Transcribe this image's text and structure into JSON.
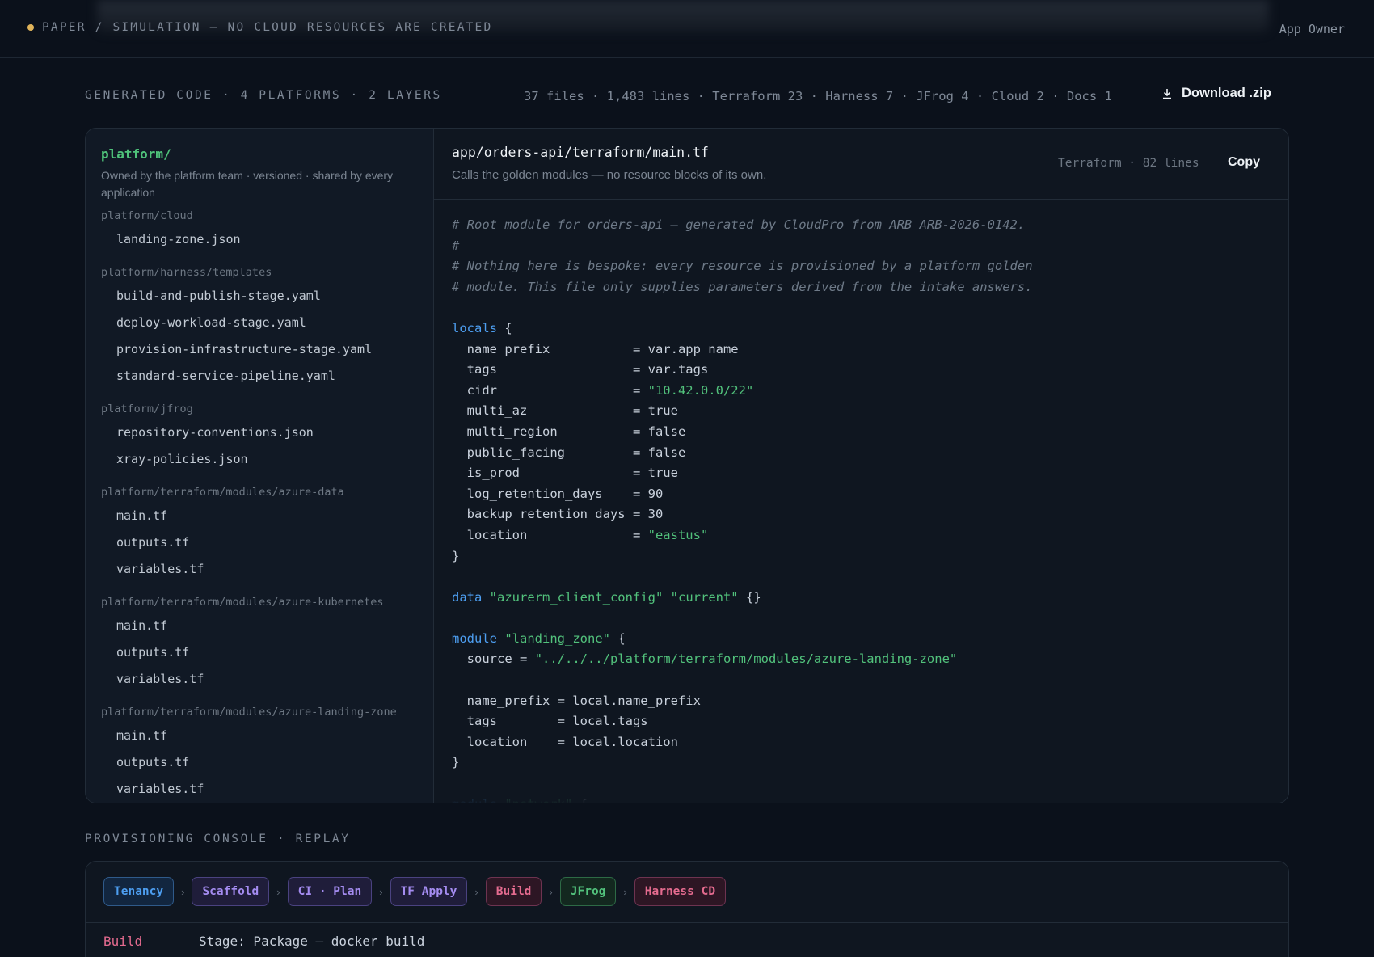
{
  "topbar": {
    "status": "PAPER / SIMULATION — NO CLOUD RESOURCES ARE CREATED",
    "role": "App Owner"
  },
  "summary": {
    "heading": "GENERATED CODE · 4 PLATFORMS · 2 LAYERS",
    "stats": "37 files · 1,483 lines · Terraform 23 · Harness 7 · JFrog 4 · Cloud 2 · Docs 1",
    "download_label": "Download .zip"
  },
  "tree": {
    "root": "platform/",
    "description": "Owned by the platform team · versioned · shared by every application",
    "groups": [
      {
        "name": "platform/cloud",
        "files": [
          "landing-zone.json"
        ]
      },
      {
        "name": "platform/harness/templates",
        "files": [
          "build-and-publish-stage.yaml",
          "deploy-workload-stage.yaml",
          "provision-infrastructure-stage.yaml",
          "standard-service-pipeline.yaml"
        ]
      },
      {
        "name": "platform/jfrog",
        "files": [
          "repository-conventions.json",
          "xray-policies.json"
        ]
      },
      {
        "name": "platform/terraform/modules/azure-data",
        "files": [
          "main.tf",
          "outputs.tf",
          "variables.tf"
        ]
      },
      {
        "name": "platform/terraform/modules/azure-kubernetes",
        "files": [
          "main.tf",
          "outputs.tf",
          "variables.tf"
        ]
      },
      {
        "name": "platform/terraform/modules/azure-landing-zone",
        "files": [
          "main.tf",
          "outputs.tf",
          "variables.tf"
        ]
      }
    ]
  },
  "editor": {
    "path": "app/orders-api/terraform/main.tf",
    "description": "Calls the golden modules — no resource blocks of its own.",
    "meta": "Terraform · 82 lines",
    "copy_label": "Copy",
    "code": [
      [
        [
          "cm",
          "# Root module for orders-api — generated by CloudPro from ARB ARB-2026-0142."
        ]
      ],
      [
        [
          "cm",
          "#"
        ]
      ],
      [
        [
          "cm",
          "# Nothing here is bespoke: every resource is provisioned by a platform golden"
        ]
      ],
      [
        [
          "cm",
          "# module. This file only supplies parameters derived from the intake answers."
        ]
      ],
      [],
      [
        [
          "kw",
          "locals"
        ],
        [
          "",
          " {"
        ]
      ],
      [
        [
          "",
          "  name_prefix           = var.app_name"
        ]
      ],
      [
        [
          "",
          "  tags                  = var.tags"
        ]
      ],
      [
        [
          "",
          "  cidr                  = "
        ],
        [
          "st",
          "\"10.42.0.0/22\""
        ]
      ],
      [
        [
          "",
          "  multi_az              = true"
        ]
      ],
      [
        [
          "",
          "  multi_region          = false"
        ]
      ],
      [
        [
          "",
          "  public_facing         = false"
        ]
      ],
      [
        [
          "",
          "  is_prod               = true"
        ]
      ],
      [
        [
          "",
          "  log_retention_days    = 90"
        ]
      ],
      [
        [
          "",
          "  backup_retention_days = 30"
        ]
      ],
      [
        [
          "",
          "  location              = "
        ],
        [
          "st",
          "\"eastus\""
        ]
      ],
      [
        [
          "",
          "}"
        ]
      ],
      [],
      [
        [
          "kw",
          "data"
        ],
        [
          "",
          " "
        ],
        [
          "st",
          "\"azurerm_client_config\""
        ],
        [
          "",
          " "
        ],
        [
          "st",
          "\"current\""
        ],
        [
          "",
          " {}"
        ]
      ],
      [],
      [
        [
          "kw",
          "module"
        ],
        [
          "",
          " "
        ],
        [
          "st",
          "\"landing_zone\""
        ],
        [
          "",
          " {"
        ]
      ],
      [
        [
          "",
          "  source = "
        ],
        [
          "st",
          "\"../../../platform/terraform/modules/azure-landing-zone\""
        ]
      ],
      [],
      [
        [
          "",
          "  name_prefix = local.name_prefix"
        ]
      ],
      [
        [
          "",
          "  tags        = local.tags"
        ]
      ],
      [
        [
          "",
          "  location    = local.location"
        ]
      ],
      [
        [
          "",
          "}"
        ]
      ],
      [],
      [
        [
          "kw",
          "module"
        ],
        [
          "",
          " "
        ],
        [
          "st",
          "\"network\""
        ],
        [
          "",
          " {"
        ]
      ]
    ]
  },
  "console": {
    "heading": "PROVISIONING CONSOLE · REPLAY",
    "stages": [
      {
        "label": "Tenancy",
        "color": "#4d9ef0",
        "bg": "#12263f",
        "border": "#2f5a8a"
      },
      {
        "label": "Scaffold",
        "color": "#a48cf0",
        "bg": "#1f1d3a",
        "border": "#4a4280"
      },
      {
        "label": "CI · Plan",
        "color": "#a48cf0",
        "bg": "#1f1d3a",
        "border": "#4a4280"
      },
      {
        "label": "TF Apply",
        "color": "#a48cf0",
        "bg": "#1f1d3a",
        "border": "#4a4280"
      },
      {
        "label": "Build",
        "color": "#e46b8f",
        "bg": "#2d1624",
        "border": "#6e3350"
      },
      {
        "label": "JFrog",
        "color": "#52c27c",
        "bg": "#13281f",
        "border": "#2d6a45"
      },
      {
        "label": "Harness CD",
        "color": "#e46b8f",
        "bg": "#2d1624",
        "border": "#6e3350"
      }
    ],
    "log": {
      "stage": "Build",
      "message": "Stage: Package — docker build"
    }
  }
}
